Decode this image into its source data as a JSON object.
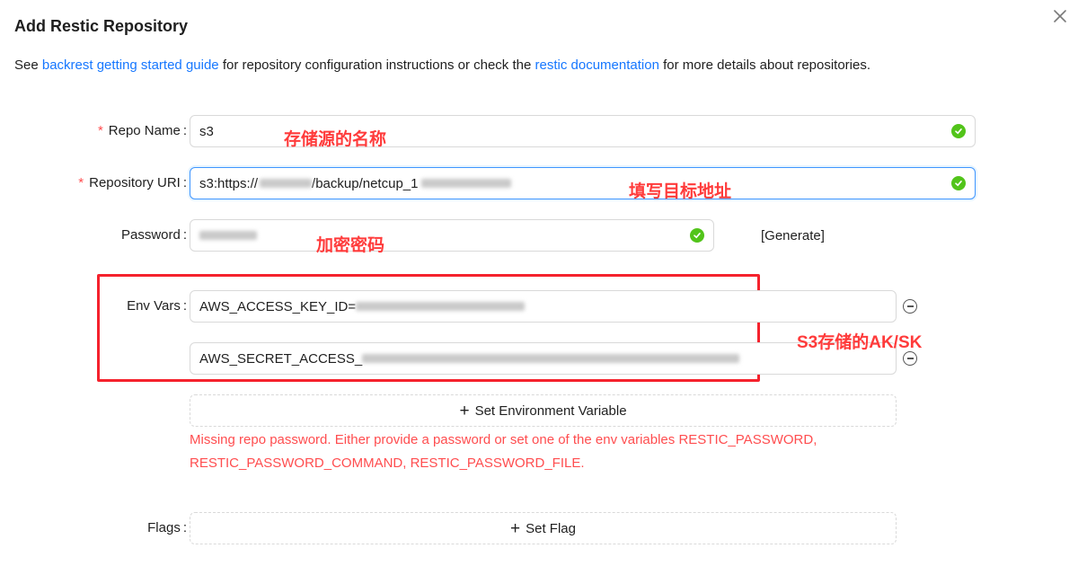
{
  "dialog": {
    "title": "Add Restic Repository",
    "close_icon": "close-icon"
  },
  "description": {
    "prefix": "See ",
    "link1": "backrest getting started guide",
    "middle": " for repository configuration instructions or check the ",
    "link2": "restic documentation",
    "suffix": " for more details about repositories."
  },
  "form": {
    "repo_name": {
      "label": "Repo Name",
      "required_mark": "*",
      "value": "s3",
      "annotation": "存储源的名称"
    },
    "repo_uri": {
      "label": "Repository URI",
      "required_mark": "*",
      "value_prefix": "s3:https://",
      "value_middle": "/backup/netcup_1",
      "annotation": "填写目标地址"
    },
    "password": {
      "label": "Password",
      "annotation": "加密密码",
      "generate_label": "[Generate]"
    },
    "env_vars": {
      "label": "Env Vars",
      "items": [
        {
          "value": "AWS_ACCESS_KEY_ID="
        },
        {
          "value": "AWS_SECRET_ACCESS_"
        }
      ],
      "annotation": "S3存储的AK/SK",
      "add_label": "Set Environment Variable"
    },
    "error": {
      "line1": "Missing repo password. Either provide a password or set one of the env variables RESTIC_PASSWORD,",
      "line2": "RESTIC_PASSWORD_COMMAND, RESTIC_PASSWORD_FILE."
    },
    "flags": {
      "label": "Flags",
      "add_label": "Set Flag"
    },
    "colon": ":"
  },
  "colors": {
    "accent": "#1677ff",
    "error": "#ff4d4f",
    "success": "#52c41a",
    "annotation": "#ff3b3b"
  }
}
